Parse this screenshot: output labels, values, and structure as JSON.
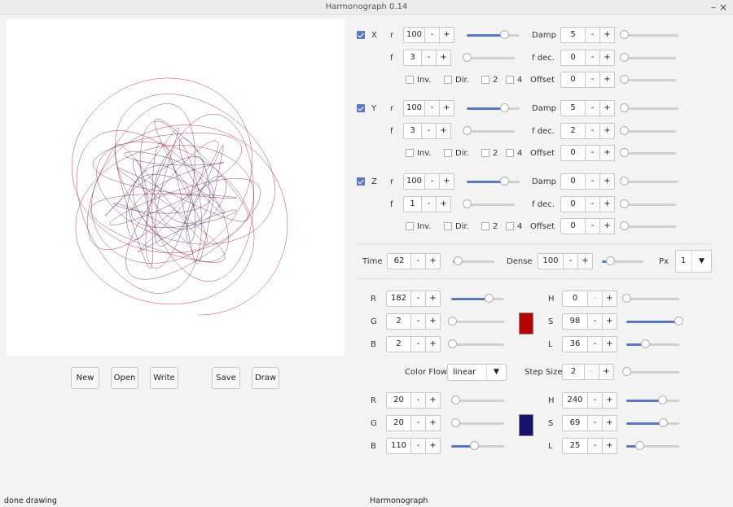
{
  "window": {
    "title": "Harmonograph 0.14",
    "minimize_glyph": "–",
    "close_glyph": "×"
  },
  "buttons": {
    "new": "New",
    "open": "Open",
    "write": "Write",
    "save": "Save",
    "draw": "Draw"
  },
  "oscillators": [
    {
      "name": "X",
      "enabled": true,
      "r": "100",
      "r_level": 0.7,
      "f": "3",
      "f_level": 0.0,
      "damp": "5",
      "damp_level": 0.0,
      "fdec": "0",
      "fdec_level": 0.0,
      "offset": "0",
      "offset_level": 0.0
    },
    {
      "name": "Y",
      "enabled": true,
      "r": "100",
      "r_level": 0.7,
      "f": "3",
      "f_level": 0.0,
      "damp": "5",
      "damp_level": 0.0,
      "fdec": "2",
      "fdec_level": 0.0,
      "offset": "0",
      "offset_level": 0.0
    },
    {
      "name": "Z",
      "enabled": true,
      "r": "100",
      "r_level": 0.7,
      "f": "1",
      "f_level": 0.0,
      "damp": "0",
      "damp_level": 0.0,
      "fdec": "0",
      "fdec_level": 0.0,
      "offset": "0",
      "offset_level": 0.0
    }
  ],
  "labels": {
    "r": "r",
    "f": "f",
    "damp": "Damp",
    "fdec": "f dec.",
    "offset": "Offset",
    "inv": "Inv.",
    "dir": "Dir.",
    "two": "2",
    "four": "4",
    "time": "Time",
    "dense": "Dense",
    "px": "Px",
    "R": "R",
    "G": "G",
    "B": "B",
    "H": "H",
    "S": "S",
    "L": "L",
    "color_flow": "Color Flow",
    "step_size": "Step Size",
    "minus": "-",
    "plus": "+"
  },
  "time": {
    "value": "62",
    "level": 0.12
  },
  "dense": {
    "value": "100",
    "level": 0.2
  },
  "px": {
    "value": "1",
    "arrow": "▼"
  },
  "color_flow": {
    "value": "linear",
    "arrow": "▼"
  },
  "step_size": {
    "value": "2",
    "level": 0.0
  },
  "start_color": {
    "R": "182",
    "G": "2",
    "B": "2",
    "H": "0",
    "S": "98",
    "L": "36",
    "R_level": 0.71,
    "G_level": 0.01,
    "B_level": 0.01,
    "H_level": 0.0,
    "S_level": 0.98,
    "L_level": 0.36,
    "hex": "#b50202"
  },
  "end_color": {
    "R": "20",
    "G": "20",
    "B": "110",
    "H": "240",
    "S": "69",
    "L": "25",
    "R_level": 0.08,
    "G_level": 0.08,
    "B_level": 0.43,
    "H_level": 0.67,
    "S_level": 0.69,
    "L_level": 0.25,
    "hex": "#14146e"
  },
  "status": {
    "left": "done drawing",
    "right": "Harmonograph"
  }
}
